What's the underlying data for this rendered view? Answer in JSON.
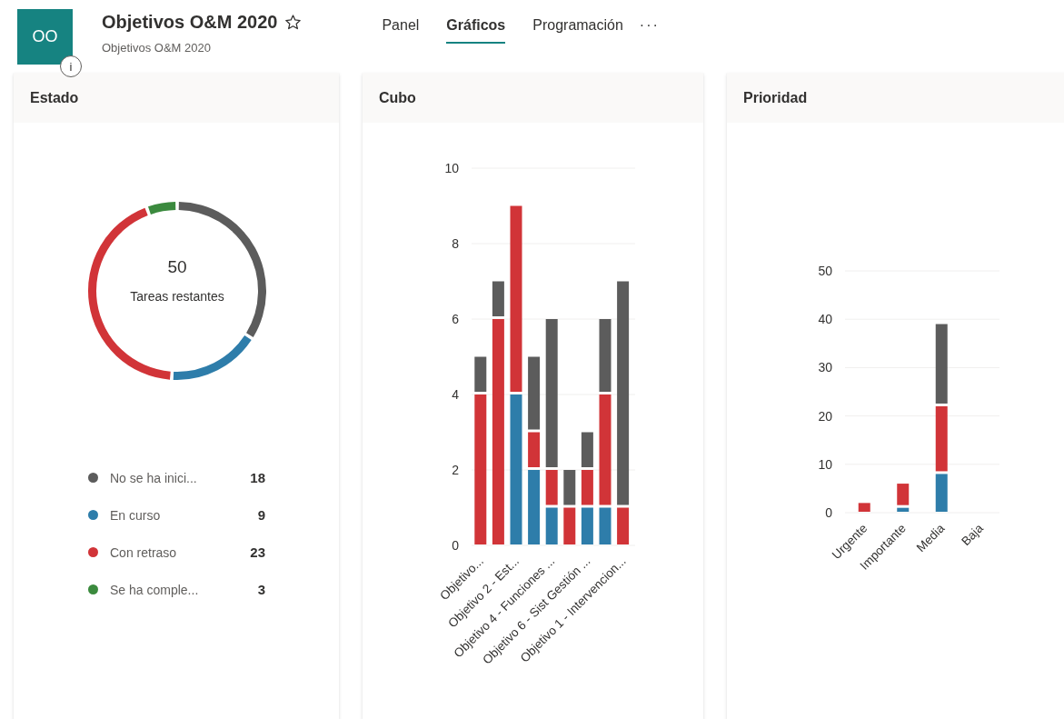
{
  "header": {
    "logo": "OO",
    "info": "i",
    "title": "Objetivos O&M 2020",
    "favorite": false,
    "subtitle": "Objetivos O&M 2020"
  },
  "tabs": [
    {
      "label": "Panel",
      "selected": false
    },
    {
      "label": "Gráficos",
      "selected": true
    },
    {
      "label": "Programación",
      "selected": false
    }
  ],
  "more": "···",
  "cards": [
    {
      "title": "Estado",
      "total": "50",
      "total_label": "Tareas restantes",
      "legend": [
        {
          "value": "18",
          "color": "#5c5c5c"
        },
        {
          "value": "9",
          "color": "#2e7daa"
        },
        {
          "value": "23",
          "color": "#d13438"
        },
        {
          "value": "3",
          "color": "#3b8a3e"
        }
      ],
      "chart_data": {
        "type": "donut",
        "categories": [
          "No se ha inici...",
          "En curso",
          "Con retraso",
          "Se ha comple..."
        ],
        "values": [
          34,
          17,
          43.4,
          5.6
        ]
      }
    },
    {
      "title": "Cubo",
      "chart_data": {
        "type": "bar",
        "stacked": true,
        "grid": true,
        "ylim": [
          0,
          10
        ],
        "yticks": [
          0,
          2,
          4,
          6,
          8,
          10
        ],
        "categories": [
          "Objetivo...",
          null,
          "Objetivo 2 - Est...",
          null,
          "Objetivo 4 - Funciones ...",
          null,
          "Objetivo 6 - Sist Gestión ...",
          null,
          "Objetivo 1 - Intervencion..."
        ],
        "series": [
          {
            "color": "#2e7daa",
            "values": [
              null,
              null,
              4,
              2,
              1,
              null,
              1,
              1,
              null
            ]
          },
          {
            "color": "#d13438",
            "values": [
              4,
              6,
              5,
              1,
              1,
              1,
              1,
              3,
              1
            ]
          },
          {
            "color": "#5c5c5c",
            "values": [
              1,
              1,
              null,
              2,
              4,
              1,
              1,
              2,
              6
            ]
          }
        ]
      }
    },
    {
      "title": "Prioridad",
      "chart_data": {
        "type": "bar",
        "stacked": true,
        "grid": true,
        "ylim": [
          0,
          50
        ],
        "yticks": [
          0,
          10,
          20,
          30,
          40,
          50
        ],
        "categories": [
          "Urgente",
          "Importante",
          "Media",
          "Baja"
        ],
        "series": [
          {
            "color": "#2e7daa",
            "values": [
              null,
              1,
              8,
              null
            ]
          },
          {
            "color": "#d13438",
            "values": [
              2,
              5,
              14,
              null
            ]
          },
          {
            "color": "#5c5c5c",
            "values": [
              null,
              null,
              17,
              null
            ]
          }
        ]
      }
    }
  ]
}
